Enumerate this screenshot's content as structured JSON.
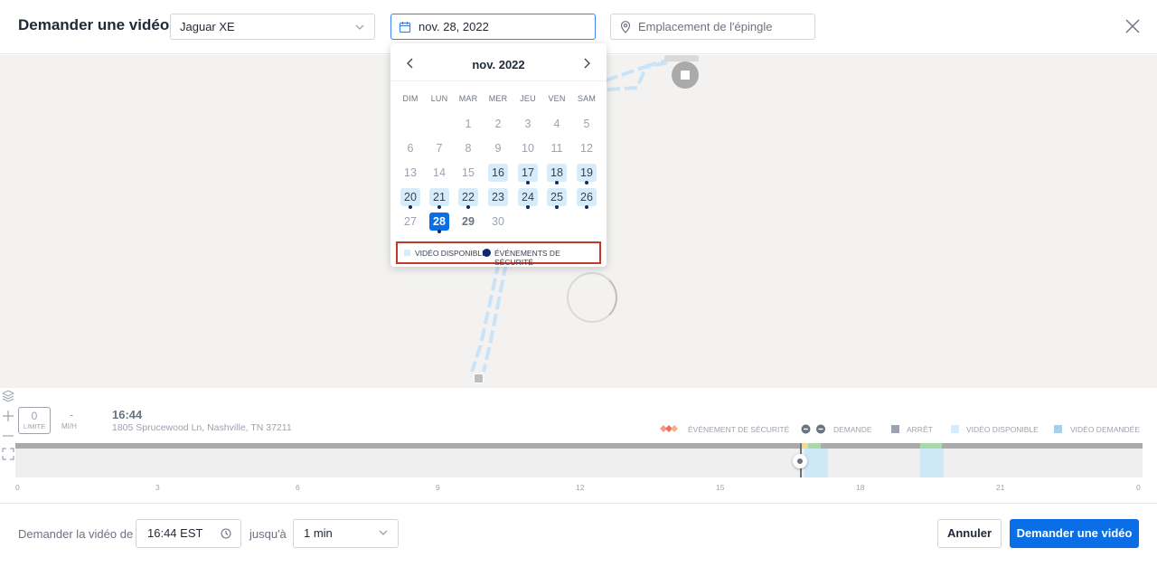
{
  "header": {
    "title": "Demander une vidéo",
    "vehicle": "Jaguar XE",
    "date": "nov. 28, 2022",
    "pin_placeholder": "Emplacement de l'épingle"
  },
  "calendar": {
    "month": "nov. 2022",
    "weekdays": [
      "DIM",
      "LUN",
      "MAR",
      "MER",
      "JEU",
      "VEN",
      "SAM"
    ],
    "first_weekday": 2,
    "days": 30,
    "available_days": [
      16,
      17,
      18,
      19,
      20,
      21,
      22,
      23,
      24,
      25,
      26
    ],
    "safety_event_days": [
      17,
      18,
      19,
      20,
      21,
      22,
      24,
      25,
      26,
      28
    ],
    "selected_day": 28,
    "bold_days": [
      29
    ],
    "legend_available": "VIDÉO DISPONIBLE",
    "legend_safety": "ÉVÉNEMENTS DE SÉCURITÉ"
  },
  "timeline": {
    "speed_limit_value": "0",
    "speed_limit_label": "LIMITE",
    "speed_value": "-",
    "speed_unit": "MI/H",
    "time": "16:44",
    "address": "1805 Sprucewood Ln, Nashville, TN 37211",
    "legend": {
      "safety_event": "ÉVÉNEMENT DE SÉCURITÉ",
      "request": "DEMANDE",
      "stop": "ARRÊT",
      "video_available": "VIDÉO DISPONIBLE",
      "video_requested": "VIDÉO DEMANDÉE"
    },
    "ticks": [
      "0",
      "3",
      "6",
      "9",
      "12",
      "15",
      "18",
      "21",
      "0"
    ]
  },
  "footer": {
    "request_from_label": "Demander la vidéo de",
    "start_time": "16:44 EST",
    "until_label": "jusqu'à",
    "duration": "1 min",
    "cancel_label": "Annuler",
    "request_label": "Demander une vidéo"
  },
  "colors": {
    "accent": "#0a6ee6",
    "available": "#d7ecfb",
    "safety_dot": "#0b2a6b",
    "requested": "#a9cfe9",
    "highlight_border": "#c0392b"
  }
}
